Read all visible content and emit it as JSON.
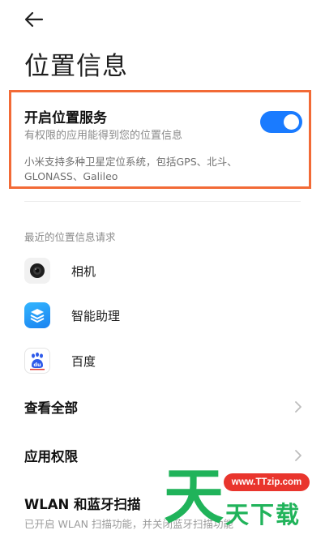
{
  "header": {
    "back_icon": "arrow-left-icon",
    "title": "位置信息"
  },
  "location_service": {
    "title": "开启位置服务",
    "subtitle": "有权限的应用能得到您的位置信息",
    "toggle_on": true,
    "gps_note": "小米支持多种卫星定位系统，包括GPS、北斗、GLONASS、Galileo",
    "accent_color": "#1a7bff",
    "highlight_color": "#f26a36"
  },
  "recent_requests": {
    "label": "最近的位置信息请求",
    "apps": [
      {
        "name": "相机",
        "icon": "camera-icon"
      },
      {
        "name": "智能助理",
        "icon": "layers-icon"
      },
      {
        "name": "百度",
        "icon": "baidu-paw-icon"
      }
    ]
  },
  "menu": {
    "view_all": "查看全部",
    "app_permissions": "应用权限",
    "wlan_bt_scan": "WLAN 和蓝牙扫描",
    "wlan_bt_sub": "已开启 WLAN 扫描功能，并关闭蓝牙扫描功能"
  },
  "watermark": {
    "big_char": "天",
    "url": "www.TTzip.com",
    "text": "天下载",
    "color": "#20b35a"
  }
}
